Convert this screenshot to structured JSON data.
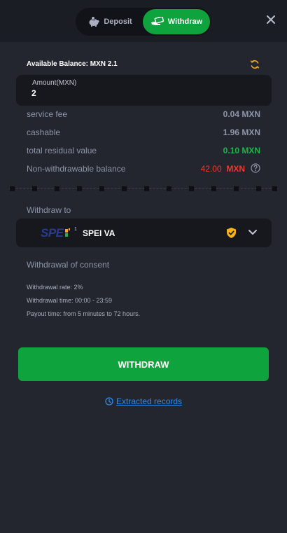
{
  "header": {
    "tabs": [
      {
        "label": "Deposit",
        "icon": "piggy-bank-icon",
        "active": false
      },
      {
        "label": "Withdraw",
        "icon": "money-hand-icon",
        "active": true
      }
    ],
    "close_icon": "close-icon"
  },
  "balance": {
    "text": "Available Balance: MXN 2.1",
    "refresh_icon": "refresh-icon",
    "refresh_color": "#f5a623"
  },
  "amount": {
    "label": "Amount(MXN)",
    "value": "2"
  },
  "summary": [
    {
      "label": "service fee",
      "value": "0.04 MXN"
    },
    {
      "label": "cashable",
      "value": "1.96 MXN"
    },
    {
      "label": "total residual value",
      "value": "0.10 MXN",
      "color": "#1fb34b"
    },
    {
      "label": "Non-withdrawable balance",
      "amount": "42.00",
      "currency": "MXN",
      "color": "#ef3b2d",
      "icon": "help-icon"
    }
  ],
  "withdraw_to": {
    "label": "Withdraw to",
    "method_name": "SPEI VA",
    "logo_text": "SPEI",
    "verified_icon": "shield-check-icon",
    "dropdown_icon": "chevron-down-icon"
  },
  "consent": {
    "label": "Withdrawal of consent"
  },
  "details": {
    "rate": "Withdrawal rate: 2%",
    "time": "Withdrawal time: 00:00 - 23:59",
    "payout": "Payout time: from 5 minutes to 72 hours."
  },
  "actions": {
    "withdraw_button": "WITHDRAW",
    "records_link": "Extracted records",
    "records_icon": "clock-icon"
  },
  "colors": {
    "accent_green": "#0fa33d",
    "link_blue": "#2f8ae8",
    "background": "#23262f"
  }
}
